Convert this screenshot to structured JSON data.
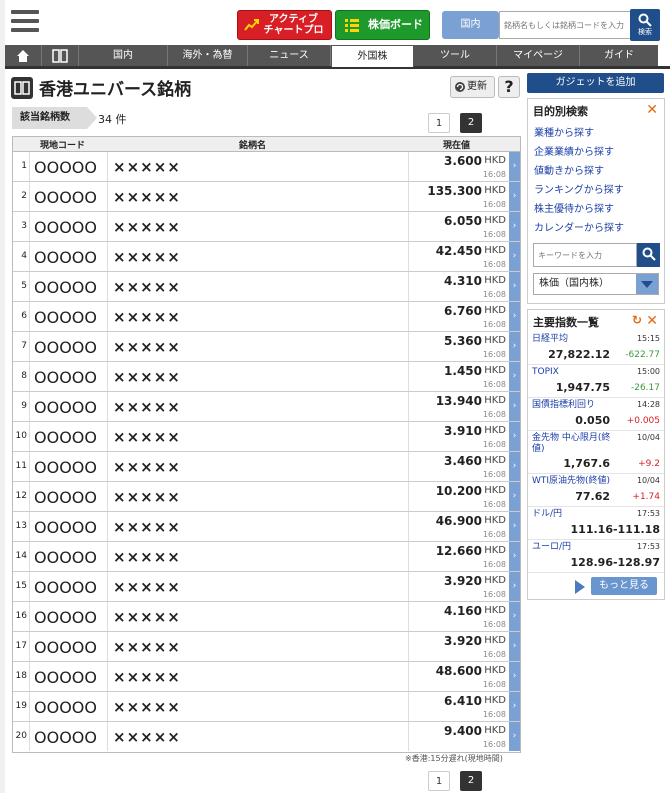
{
  "header": {
    "menu_icon": "hamburger-icon",
    "active_chart_label_1": "アクティブ",
    "active_chart_label_2": "チャートプロ",
    "stock_board_label": "株価ボード",
    "market_select_label": "国内",
    "search_placeholder": "銘柄名もしくは銘柄コードを入力",
    "search_button_label": "検索"
  },
  "nav": {
    "tabs": [
      "国内",
      "海外・為替",
      "ニュース",
      "外国株",
      "ツール",
      "マイページ",
      "ガイド"
    ],
    "active_tab": "外国株",
    "icons": [
      "home-icon",
      "book-icon"
    ]
  },
  "page": {
    "title": "香港ユニバース銘柄",
    "update_label": "更新",
    "help_label": "?",
    "count_label": "該当銘柄数",
    "count_value": "34 件",
    "pages": [
      "1",
      "2"
    ],
    "current_page": "1",
    "footnote": "※香港:15分遅れ(現地時間)"
  },
  "table": {
    "headers": {
      "code": "現地コード",
      "name": "銘柄名",
      "price": "現在値"
    },
    "rows": [
      {
        "no": "1",
        "code": "OOOOO",
        "name": "×××××",
        "price": "3.600",
        "currency": "HKD",
        "time": "16:08"
      },
      {
        "no": "2",
        "code": "OOOOO",
        "name": "×××××",
        "price": "135.300",
        "currency": "HKD",
        "time": "16:08"
      },
      {
        "no": "3",
        "code": "OOOOO",
        "name": "×××××",
        "price": "6.050",
        "currency": "HKD",
        "time": "16:08"
      },
      {
        "no": "4",
        "code": "OOOOO",
        "name": "×××××",
        "price": "42.450",
        "currency": "HKD",
        "time": "16:08"
      },
      {
        "no": "5",
        "code": "OOOOO",
        "name": "×××××",
        "price": "4.310",
        "currency": "HKD",
        "time": "16:08"
      },
      {
        "no": "6",
        "code": "OOOOO",
        "name": "×××××",
        "price": "6.760",
        "currency": "HKD",
        "time": "16:08"
      },
      {
        "no": "7",
        "code": "OOOOO",
        "name": "×××××",
        "price": "5.360",
        "currency": "HKD",
        "time": "16:08"
      },
      {
        "no": "8",
        "code": "OOOOO",
        "name": "×××××",
        "price": "1.450",
        "currency": "HKD",
        "time": "16:08"
      },
      {
        "no": "9",
        "code": "OOOOO",
        "name": "×××××",
        "price": "13.940",
        "currency": "HKD",
        "time": "16:08"
      },
      {
        "no": "10",
        "code": "OOOOO",
        "name": "×××××",
        "price": "3.910",
        "currency": "HKD",
        "time": "16:08"
      },
      {
        "no": "11",
        "code": "OOOOO",
        "name": "×××××",
        "price": "3.460",
        "currency": "HKD",
        "time": "16:08"
      },
      {
        "no": "12",
        "code": "OOOOO",
        "name": "×××××",
        "price": "10.200",
        "currency": "HKD",
        "time": "16:08"
      },
      {
        "no": "13",
        "code": "OOOOO",
        "name": "×××××",
        "price": "46.900",
        "currency": "HKD",
        "time": "16:08"
      },
      {
        "no": "14",
        "code": "OOOOO",
        "name": "×××××",
        "price": "12.660",
        "currency": "HKD",
        "time": "16:08"
      },
      {
        "no": "15",
        "code": "OOOOO",
        "name": "×××××",
        "price": "3.920",
        "currency": "HKD",
        "time": "16:08"
      },
      {
        "no": "16",
        "code": "OOOOO",
        "name": "×××××",
        "price": "4.160",
        "currency": "HKD",
        "time": "16:08"
      },
      {
        "no": "17",
        "code": "OOOOO",
        "name": "×××××",
        "price": "3.920",
        "currency": "HKD",
        "time": "16:08"
      },
      {
        "no": "18",
        "code": "OOOOO",
        "name": "×××××",
        "price": "48.600",
        "currency": "HKD",
        "time": "16:08"
      },
      {
        "no": "19",
        "code": "OOOOO",
        "name": "×××××",
        "price": "6.410",
        "currency": "HKD",
        "time": "16:08"
      },
      {
        "no": "20",
        "code": "OOOOO",
        "name": "×××××",
        "price": "9.400",
        "currency": "HKD",
        "time": "16:08"
      }
    ]
  },
  "sidebar": {
    "gadget_button": "ガジェットを追加",
    "search_panel": {
      "title": "目的別検索",
      "links": [
        "業種から探す",
        "企業業績から探す",
        "値動きから探す",
        "ランキングから探す",
        "株主優待から探す",
        "カレンダーから探す"
      ],
      "keyword_placeholder": "キーワードを入力",
      "select_value": "株価（国内株）"
    },
    "index_panel": {
      "title": "主要指数一覧",
      "indices": [
        {
          "name": "日経平均",
          "time": "15:15",
          "value": "27,822.12",
          "change": "-622.77",
          "dir": "down"
        },
        {
          "name": "TOPIX",
          "time": "15:00",
          "value": "1,947.75",
          "change": "-26.17",
          "dir": "down"
        },
        {
          "name": "国債指標利回り",
          "time": "14:28",
          "value": "0.050",
          "change": "+0.005",
          "dir": "up"
        },
        {
          "name": "金先物 中心限月(終値)",
          "time": "10/04",
          "value": "1,767.6",
          "change": "+9.2",
          "dir": "up"
        },
        {
          "name": "WTI原油先物(終値)",
          "time": "10/04",
          "value": "77.62",
          "change": "+1.74",
          "dir": "up"
        },
        {
          "name": "ドル/円",
          "time": "17:53",
          "value": "111.16-111.18",
          "change": "",
          "dir": ""
        },
        {
          "name": "ユーロ/円",
          "time": "17:53",
          "value": "128.96-128.97",
          "change": "",
          "dir": ""
        }
      ],
      "more_label": "もっと見る"
    }
  },
  "colors": {
    "nav_bg": "#555555",
    "accent_blue": "#1f4e8a",
    "row_arrow": "#7aa0d4",
    "active_btn": "#d81f26",
    "board_btn": "#1e9a2c"
  }
}
